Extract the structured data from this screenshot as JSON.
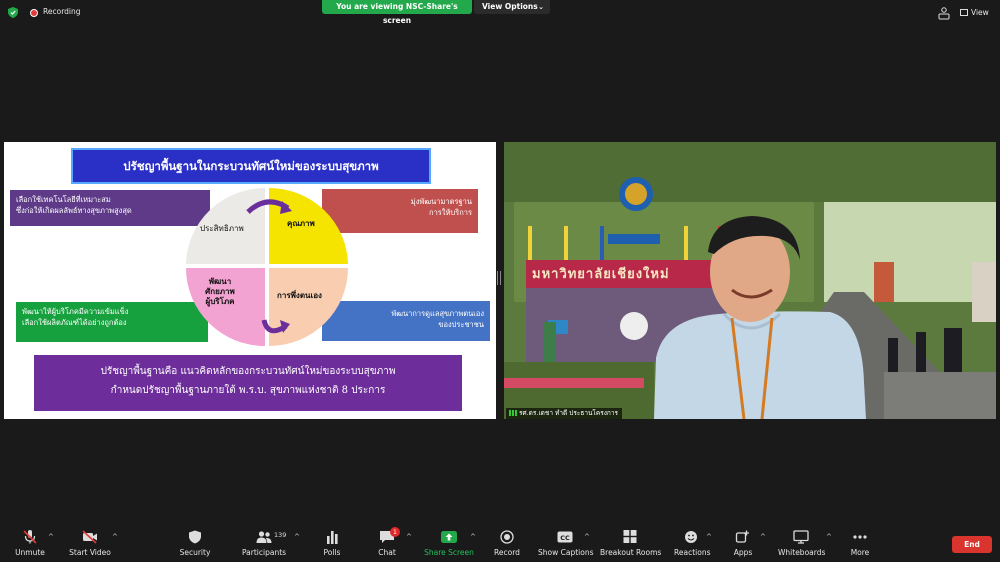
{
  "topbar": {
    "recording_label": "Recording",
    "viewing_banner": "You are viewing NSC-Share's screen",
    "view_options_label": "View Options",
    "view_label": "View"
  },
  "slide": {
    "title": "ปรัชญาพื้นฐานในกระบวนทัศน์ใหม่ของระบบสุขภาพ",
    "box_top_left": [
      "เลือกใช้เทคโนโลยีที่เหมาะสม",
      "ซึ่งก่อให้เกิดผลลัพธ์ทางสุขภาพสูงสุด"
    ],
    "box_top_right": [
      "มุ่งพัฒนามาตรฐาน",
      "การให้บริการ"
    ],
    "box_bottom_left": [
      "พัฒนาให้ผู้บริโภคมีความเข้มแข็ง",
      "เลือกใช้ผลิตภัณฑ์ได้อย่างถูกต้อง"
    ],
    "box_bottom_right": [
      "พัฒนาการดูแลสุขภาพตนเอง",
      "ของประชาชน"
    ],
    "q_top_left": "ประสิทธิภาพ",
    "q_top_right": "คุณภาพ",
    "q_bottom_left": [
      "พัฒนา",
      "ศักยภาพ",
      "ผู้บริโภค"
    ],
    "q_bottom_right": "การพึ่งตนเอง",
    "bottom_box": [
      "ปรัชญาพื้นฐานคือ แนวคิดหลักของกระบวนทัศน์ใหม่ของระบบสุขภาพ",
      "กำหนดปรัชญาพื้นฐานภายใต้ พ.ร.บ. สุขภาพแห่งชาติ 8 ประการ"
    ]
  },
  "video": {
    "sign_text": "มหาวิทยาลัยเชียงใหม่",
    "participant_name": "รศ.ดร.เดชา ทำดี ประธานโครงการ"
  },
  "toolbar": {
    "unmute": "Unmute",
    "start_video": "Start Video",
    "security": "Security",
    "participants": "Participants",
    "participants_count": "139",
    "polls": "Polls",
    "chat": "Chat",
    "chat_badge": "1",
    "share_screen": "Share Screen",
    "record": "Record",
    "show_captions": "Show Captions",
    "breakout_rooms": "Breakout Rooms",
    "reactions": "Reactions",
    "apps": "Apps",
    "whiteboards": "Whiteboards",
    "more": "More",
    "end": "End"
  },
  "colors": {
    "share_green": "#23a94b",
    "end_red": "#d9342e",
    "slide_title_blue": "#2a2fc6"
  }
}
